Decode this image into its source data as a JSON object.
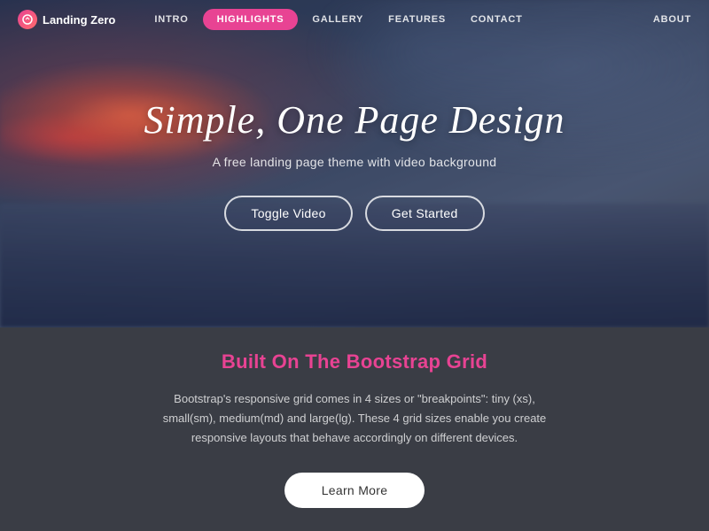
{
  "nav": {
    "logo_label": "Landing Zero",
    "links": [
      {
        "id": "intro",
        "label": "INTRO",
        "active": false
      },
      {
        "id": "highlights",
        "label": "HIGHLIGHTS",
        "active": true
      },
      {
        "id": "gallery",
        "label": "GALLERY",
        "active": false
      },
      {
        "id": "features",
        "label": "FEATURES",
        "active": false
      },
      {
        "id": "contact",
        "label": "CONTACT",
        "active": false
      }
    ],
    "about_label": "ABOUT"
  },
  "hero": {
    "title": "Simple, One Page Design",
    "subtitle": "A free landing page theme with video background",
    "toggle_video_label": "Toggle Video",
    "get_started_label": "Get Started"
  },
  "section": {
    "title": "Built On The Bootstrap Grid",
    "body": "Bootstrap's responsive grid comes in 4 sizes or \"breakpoints\": tiny (xs), small(sm), medium(md) and large(lg). These 4 grid sizes enable you create responsive layouts that behave accordingly on different devices.",
    "learn_more_label": "Learn More"
  }
}
